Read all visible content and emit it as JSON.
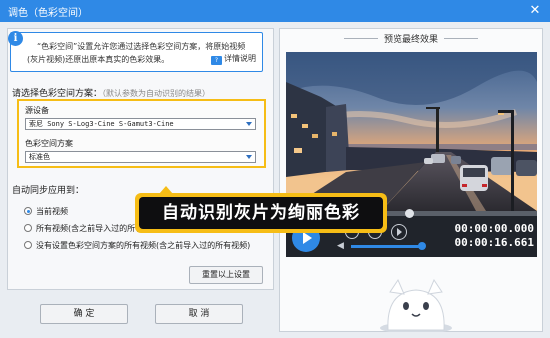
{
  "window": {
    "title": "调色（色彩空间）",
    "close_icon": "close-icon"
  },
  "info": {
    "line1": "“色彩空间”设置允许您通过选择色彩空间方案，将原始视频",
    "line2": "(灰片视频)还原出原本真实的色彩效果。",
    "help_label": "详情说明"
  },
  "scheme": {
    "label": "请选择色彩空间方案：",
    "hint": "（默认参数为自动识别的结果）",
    "device_label": "源设备",
    "device_value": "索尼 Sony S-Log3-Cine S-Gamut3-Cine",
    "space_label": "色彩空间方案",
    "space_value": "标准色"
  },
  "sync": {
    "label": "自动同步应用到：",
    "options": [
      {
        "label": "当前视频",
        "selected": true
      },
      {
        "label": "所有视频(含之前导入过的所有视频)",
        "selected": false
      },
      {
        "label": "没有设置色彩空间方案的所有视频(含之前导入过的所有视频)",
        "selected": false
      }
    ]
  },
  "buttons": {
    "reset": "重置以上设置",
    "ok": "确  定",
    "cancel": "取  消"
  },
  "preview": {
    "title": "预览最终效果",
    "time_current": "00:00:00.000",
    "time_total": "00:00:16.661",
    "seek_progress": 0.49,
    "volume_level": 0.96
  },
  "callout": {
    "text": "自动识别灰片为绚丽色彩"
  },
  "colors": {
    "accent": "#2f89e6",
    "highlight": "#f6bd16",
    "callout_bg": "#0e0e10"
  }
}
